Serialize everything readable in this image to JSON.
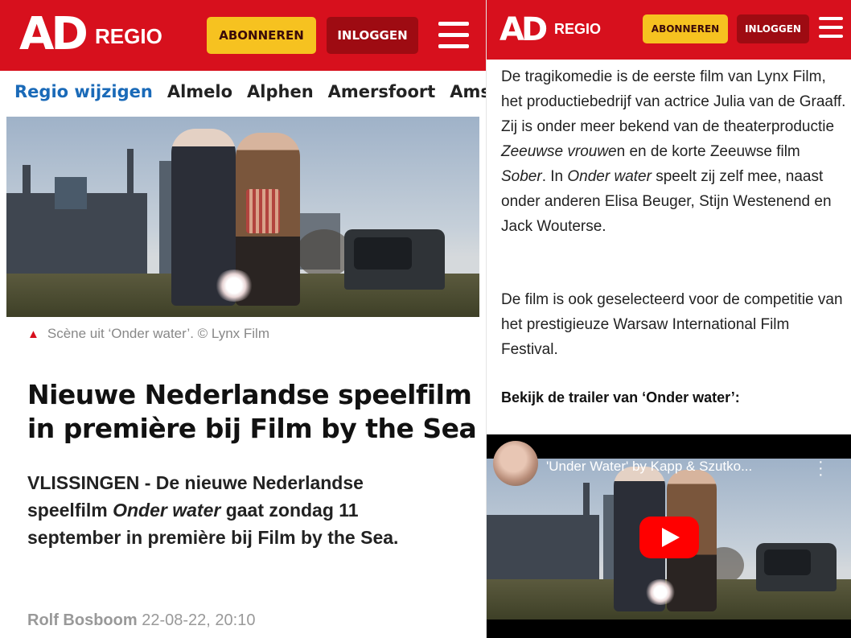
{
  "header": {
    "logo": "AD",
    "section": "REGIO",
    "subscribe_label": "ABONNEREN",
    "login_label": "INLOGGEN"
  },
  "regio_nav": {
    "change_label": "Regio wijzigen",
    "items": [
      "Almelo",
      "Alphen",
      "Amersfoort",
      "Amsterdam"
    ]
  },
  "article": {
    "caption": "Scène uit ‘Onder water’. © Lynx Film",
    "title": "Nieuwe Nederlandse speelfilm in première bij Film by the Sea",
    "intro_part1": "VLISSINGEN - De nieuwe Nederlandse speelfilm ",
    "intro_em": "Onder water",
    "intro_part2": " gaat zondag 11 september in première bij Film by the Sea.",
    "author": "Rolf Bosboom",
    "date": "22-08-22, 20:10"
  },
  "body": {
    "p1_a": "De tragikomedie is de eerste film van Lynx Film, het productiebedrijf van actrice Julia van de Graaff. Zij is onder meer bekend van de theaterproductie ",
    "p1_em1": "Zeeuwse vrouwe",
    "p1_b": "n en de korte Zeeuwse film ",
    "p1_em2": "Sober",
    "p1_c": ". In ",
    "p1_em3": "Onder water",
    "p1_d": " speelt zij zelf mee, naast onder anderen Elisa Beuger, Stijn Westenend en Jack Wouterse.",
    "p2": "De film is ook geselecteerd voor de competitie van het prestigieuze Warsaw International Film Festival.",
    "trailer_heading": "Bekijk de trailer van ‘Onder water’:"
  },
  "video": {
    "title": "'Under Water' by Kapp & Szutko...",
    "menu_icon": "kebab-icon",
    "play_icon": "play-icon"
  },
  "colors": {
    "brand_red": "#d7101d",
    "subscribe_yellow": "#f6c220",
    "login_dark_red": "#9e0b12",
    "link_blue": "#1a6ab8"
  }
}
